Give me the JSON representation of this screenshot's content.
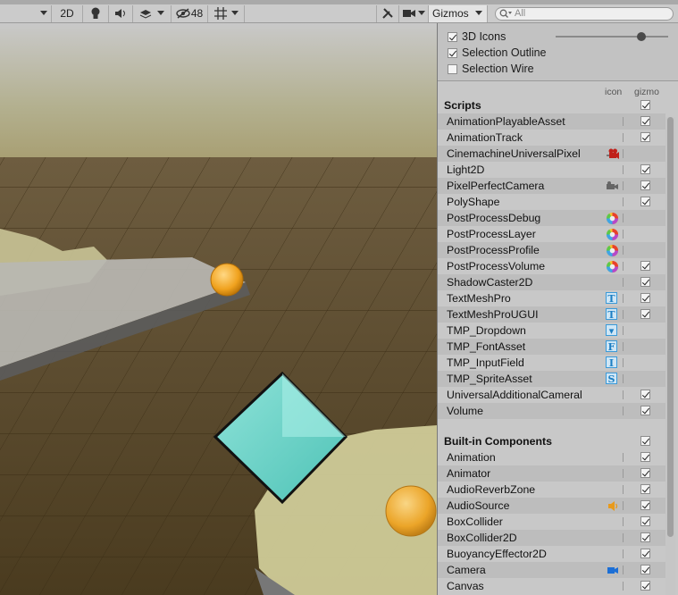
{
  "toolbar": {
    "mode_2d": "2D",
    "hidden_count": "48",
    "gizmos_label": "Gizmos",
    "search_placeholder": "All"
  },
  "gizmos_panel": {
    "options": [
      {
        "label": "3D Icons",
        "checked": true
      },
      {
        "label": "Selection Outline",
        "checked": true
      },
      {
        "label": "Selection Wire",
        "checked": false
      }
    ],
    "icon_size_slider": 0.8,
    "col_icon": "icon",
    "col_gizmo": "gizmo",
    "sections": [
      {
        "title": "Scripts",
        "checked": true,
        "items": [
          {
            "name": "AnimationPlayableAsset",
            "icon": "",
            "checked": true
          },
          {
            "name": "AnimationTrack",
            "icon": "",
            "checked": true
          },
          {
            "name": "CinemachineUniversalPixel",
            "icon": "cinemachine-icon",
            "checked": null
          },
          {
            "name": "Light2D",
            "icon": "",
            "checked": true
          },
          {
            "name": "PixelPerfectCamera",
            "icon": "camera-small-icon",
            "checked": true
          },
          {
            "name": "PolyShape",
            "icon": "",
            "checked": true
          },
          {
            "name": "PostProcessDebug",
            "icon": "color-wheel-icon",
            "checked": null
          },
          {
            "name": "PostProcessLayer",
            "icon": "color-wheel-icon",
            "checked": null
          },
          {
            "name": "PostProcessProfile",
            "icon": "color-wheel-icon",
            "checked": null
          },
          {
            "name": "PostProcessVolume",
            "icon": "color-wheel-icon",
            "checked": true
          },
          {
            "name": "ShadowCaster2D",
            "icon": "",
            "checked": true
          },
          {
            "name": "TextMeshPro",
            "icon": "text-t-icon",
            "glyph": "T",
            "checked": true
          },
          {
            "name": "TextMeshProUGUI",
            "icon": "text-t-icon",
            "glyph": "T",
            "checked": true
          },
          {
            "name": "TMP_Dropdown",
            "icon": "dropdown-icon",
            "glyph": "▾",
            "checked": null
          },
          {
            "name": "TMP_FontAsset",
            "icon": "font-asset-icon",
            "glyph": "F",
            "checked": null
          },
          {
            "name": "TMP_InputField",
            "icon": "input-field-icon",
            "glyph": "I",
            "checked": null
          },
          {
            "name": "TMP_SpriteAsset",
            "icon": "sprite-asset-icon",
            "glyph": "S",
            "checked": null
          },
          {
            "name": "UniversalAdditionalCameral",
            "icon": "",
            "checked": true
          },
          {
            "name": "Volume",
            "icon": "",
            "checked": true
          }
        ]
      },
      {
        "title": "Built-in Components",
        "checked": true,
        "items": [
          {
            "name": "Animation",
            "icon": "",
            "checked": true
          },
          {
            "name": "Animator",
            "icon": "",
            "checked": true
          },
          {
            "name": "AudioReverbZone",
            "icon": "",
            "checked": true
          },
          {
            "name": "AudioSource",
            "icon": "speaker-icon",
            "checked": true
          },
          {
            "name": "BoxCollider",
            "icon": "",
            "checked": true
          },
          {
            "name": "BoxCollider2D",
            "icon": "",
            "checked": true
          },
          {
            "name": "BuoyancyEffector2D",
            "icon": "",
            "checked": true
          },
          {
            "name": "Camera",
            "icon": "camera-icon",
            "checked": true
          },
          {
            "name": "Canvas",
            "icon": "",
            "checked": true
          }
        ]
      }
    ]
  }
}
